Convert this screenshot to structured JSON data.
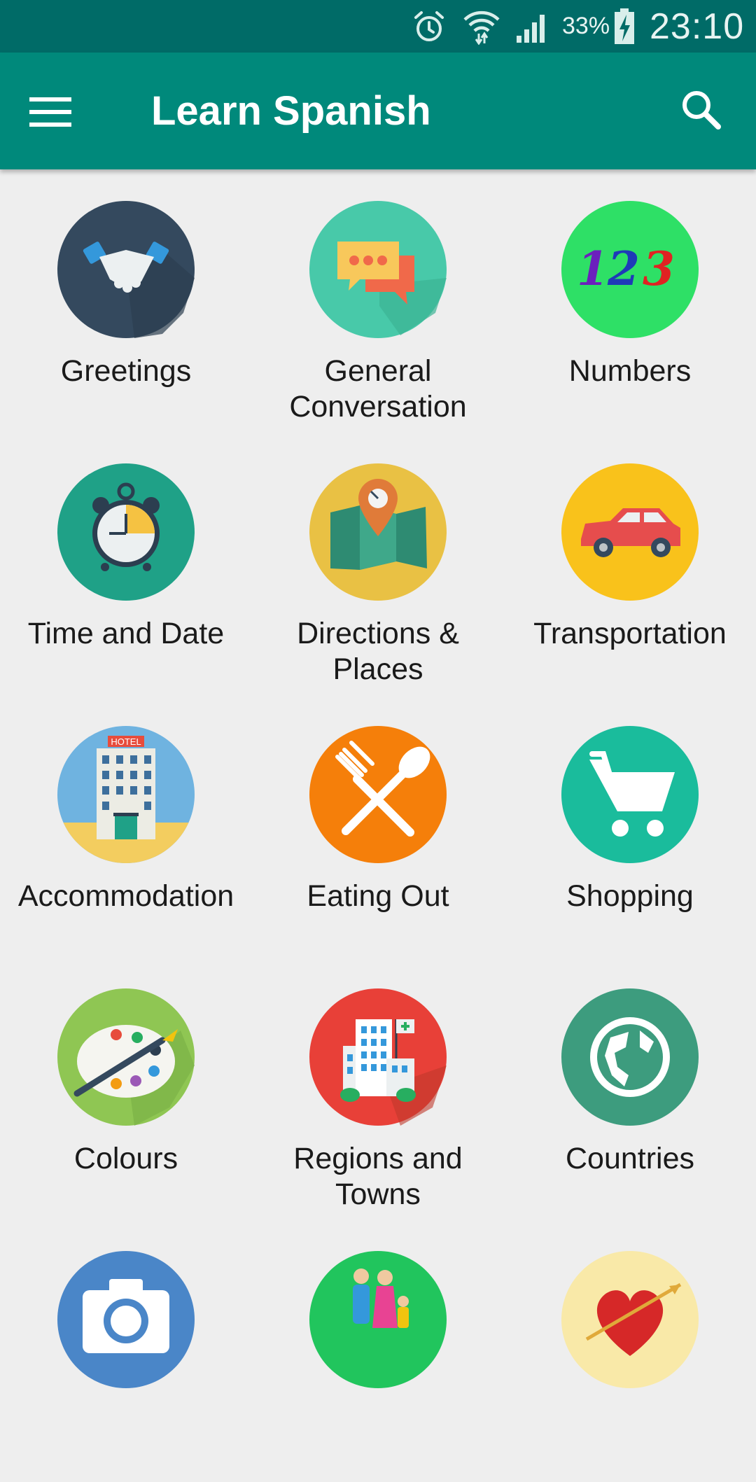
{
  "status_bar": {
    "battery_percent": "33%",
    "time": "23:10",
    "icons": [
      "alarm-icon",
      "wifi-icon",
      "signal-icon",
      "battery-charging-icon"
    ]
  },
  "app_bar": {
    "title": "Learn Spanish",
    "menu_icon": "hamburger-menu-icon",
    "search_icon": "search-icon"
  },
  "categories": [
    {
      "label": "Greetings",
      "icon": "handshake-icon",
      "color": "#34495e"
    },
    {
      "label": "General Conversation",
      "icon": "chat-bubbles-icon",
      "color": "#48c9a9"
    },
    {
      "label": "Numbers",
      "icon": "numbers-123-icon",
      "color": "#2ee066"
    },
    {
      "label": "Time and Date",
      "icon": "alarm-clock-icon",
      "color": "#1fa187"
    },
    {
      "label": "Directions & Places",
      "icon": "map-pin-icon",
      "color": "#e9c144"
    },
    {
      "label": "Transportation",
      "icon": "car-icon",
      "color": "#f9c21b"
    },
    {
      "label": "Accommodation",
      "icon": "hotel-icon",
      "color": "#6fb3e0"
    },
    {
      "label": "Eating Out",
      "icon": "fork-spoon-icon",
      "color": "#f57f0a"
    },
    {
      "label": "Shopping",
      "icon": "shopping-cart-icon",
      "color": "#1abc9c"
    },
    {
      "label": "Colours",
      "icon": "paint-palette-icon",
      "color": "#8fc653"
    },
    {
      "label": "Regions and Towns",
      "icon": "city-buildings-icon",
      "color": "#e84038"
    },
    {
      "label": "Countries",
      "icon": "globe-icon",
      "color": "#3d9c7e"
    },
    {
      "label": "",
      "icon": "camera-icon",
      "color": "#4a86c8"
    },
    {
      "label": "",
      "icon": "family-icon",
      "color": "#21c55d"
    },
    {
      "label": "",
      "icon": "heart-arrow-icon",
      "color": "#f9e9a8"
    }
  ]
}
